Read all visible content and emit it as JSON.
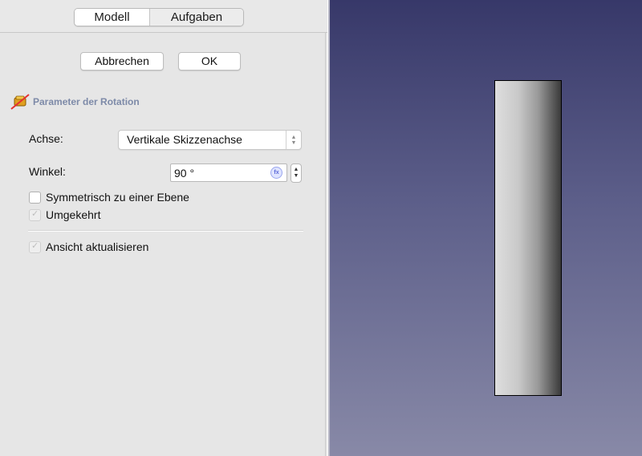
{
  "tabs": [
    {
      "label": "Modell",
      "active": true
    },
    {
      "label": "Aufgaben",
      "active": false
    }
  ],
  "actions": {
    "cancel_label": "Abbrechen",
    "ok_label": "OK"
  },
  "section": {
    "title": "Parameter der Rotation",
    "icon": "revolution-icon"
  },
  "axis": {
    "label": "Achse:",
    "selected": "Vertikale Skizzenachse"
  },
  "angle": {
    "label": "Winkel:",
    "value": "90 °",
    "expression_icon": "fx"
  },
  "options": {
    "symmetric": {
      "label": "Symmetrisch zu einer Ebene",
      "checked": false,
      "enabled": true
    },
    "reversed": {
      "label": "Umgekehrt",
      "checked": true,
      "enabled": false
    },
    "update_view": {
      "label": "Ansicht aktualisieren",
      "checked": true,
      "enabled": false
    }
  },
  "colors": {
    "view_top": "#373869",
    "view_bottom": "#8889a7",
    "section_title": "#7d8aa8"
  }
}
